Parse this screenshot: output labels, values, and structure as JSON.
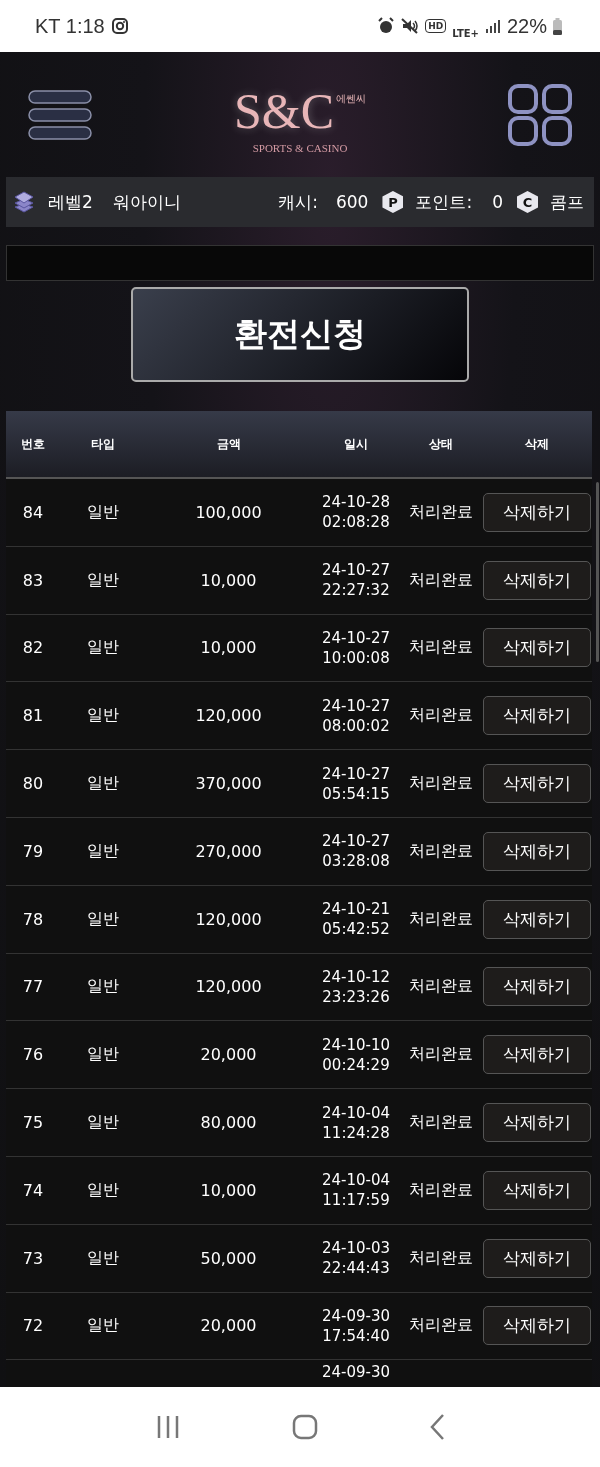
{
  "status_bar": {
    "carrier_time": "KT 1:18",
    "network": "LTE+",
    "hd": "HD",
    "battery": "22%"
  },
  "header": {
    "logo": {
      "mark": "S&C",
      "korean": "에쎈씨",
      "tagline": "SPORTS & CASINO"
    }
  },
  "info_bar": {
    "level": "레벨2",
    "username": "워아이니",
    "cash_label": "캐시:",
    "cash": "600",
    "point_badge": "P",
    "point_label": "포인트:",
    "points": "0",
    "comp_badge": "C",
    "comp_label": "콤프"
  },
  "request_button": "환전신청",
  "table": {
    "columns": [
      "번호",
      "타입",
      "금액",
      "일시",
      "상태",
      "삭제"
    ],
    "rows": [
      {
        "no": "84",
        "type": "일반",
        "amount": "100,000",
        "date": "24-10-28",
        "time": "02:08:28",
        "status": "처리완료",
        "action": "삭제하기"
      },
      {
        "no": "83",
        "type": "일반",
        "amount": "10,000",
        "date": "24-10-27",
        "time": "22:27:32",
        "status": "처리완료",
        "action": "삭제하기"
      },
      {
        "no": "82",
        "type": "일반",
        "amount": "10,000",
        "date": "24-10-27",
        "time": "10:00:08",
        "status": "처리완료",
        "action": "삭제하기"
      },
      {
        "no": "81",
        "type": "일반",
        "amount": "120,000",
        "date": "24-10-27",
        "time": "08:00:02",
        "status": "처리완료",
        "action": "삭제하기"
      },
      {
        "no": "80",
        "type": "일반",
        "amount": "370,000",
        "date": "24-10-27",
        "time": "05:54:15",
        "status": "처리완료",
        "action": "삭제하기"
      },
      {
        "no": "79",
        "type": "일반",
        "amount": "270,000",
        "date": "24-10-27",
        "time": "03:28:08",
        "status": "처리완료",
        "action": "삭제하기"
      },
      {
        "no": "78",
        "type": "일반",
        "amount": "120,000",
        "date": "24-10-21",
        "time": "05:42:52",
        "status": "처리완료",
        "action": "삭제하기"
      },
      {
        "no": "77",
        "type": "일반",
        "amount": "120,000",
        "date": "24-10-12",
        "time": "23:23:26",
        "status": "처리완료",
        "action": "삭제하기"
      },
      {
        "no": "76",
        "type": "일반",
        "amount": "20,000",
        "date": "24-10-10",
        "time": "00:24:29",
        "status": "처리완료",
        "action": "삭제하기"
      },
      {
        "no": "75",
        "type": "일반",
        "amount": "80,000",
        "date": "24-10-04",
        "time": "11:24:28",
        "status": "처리완료",
        "action": "삭제하기"
      },
      {
        "no": "74",
        "type": "일반",
        "amount": "10,000",
        "date": "24-10-04",
        "time": "11:17:59",
        "status": "처리완료",
        "action": "삭제하기"
      },
      {
        "no": "73",
        "type": "일반",
        "amount": "50,000",
        "date": "24-10-03",
        "time": "22:44:43",
        "status": "처리완료",
        "action": "삭제하기"
      },
      {
        "no": "72",
        "type": "일반",
        "amount": "20,000",
        "date": "24-09-30",
        "time": "17:54:40",
        "status": "처리완료",
        "action": "삭제하기"
      }
    ],
    "partial_row": {
      "date": "24-09-30"
    }
  }
}
